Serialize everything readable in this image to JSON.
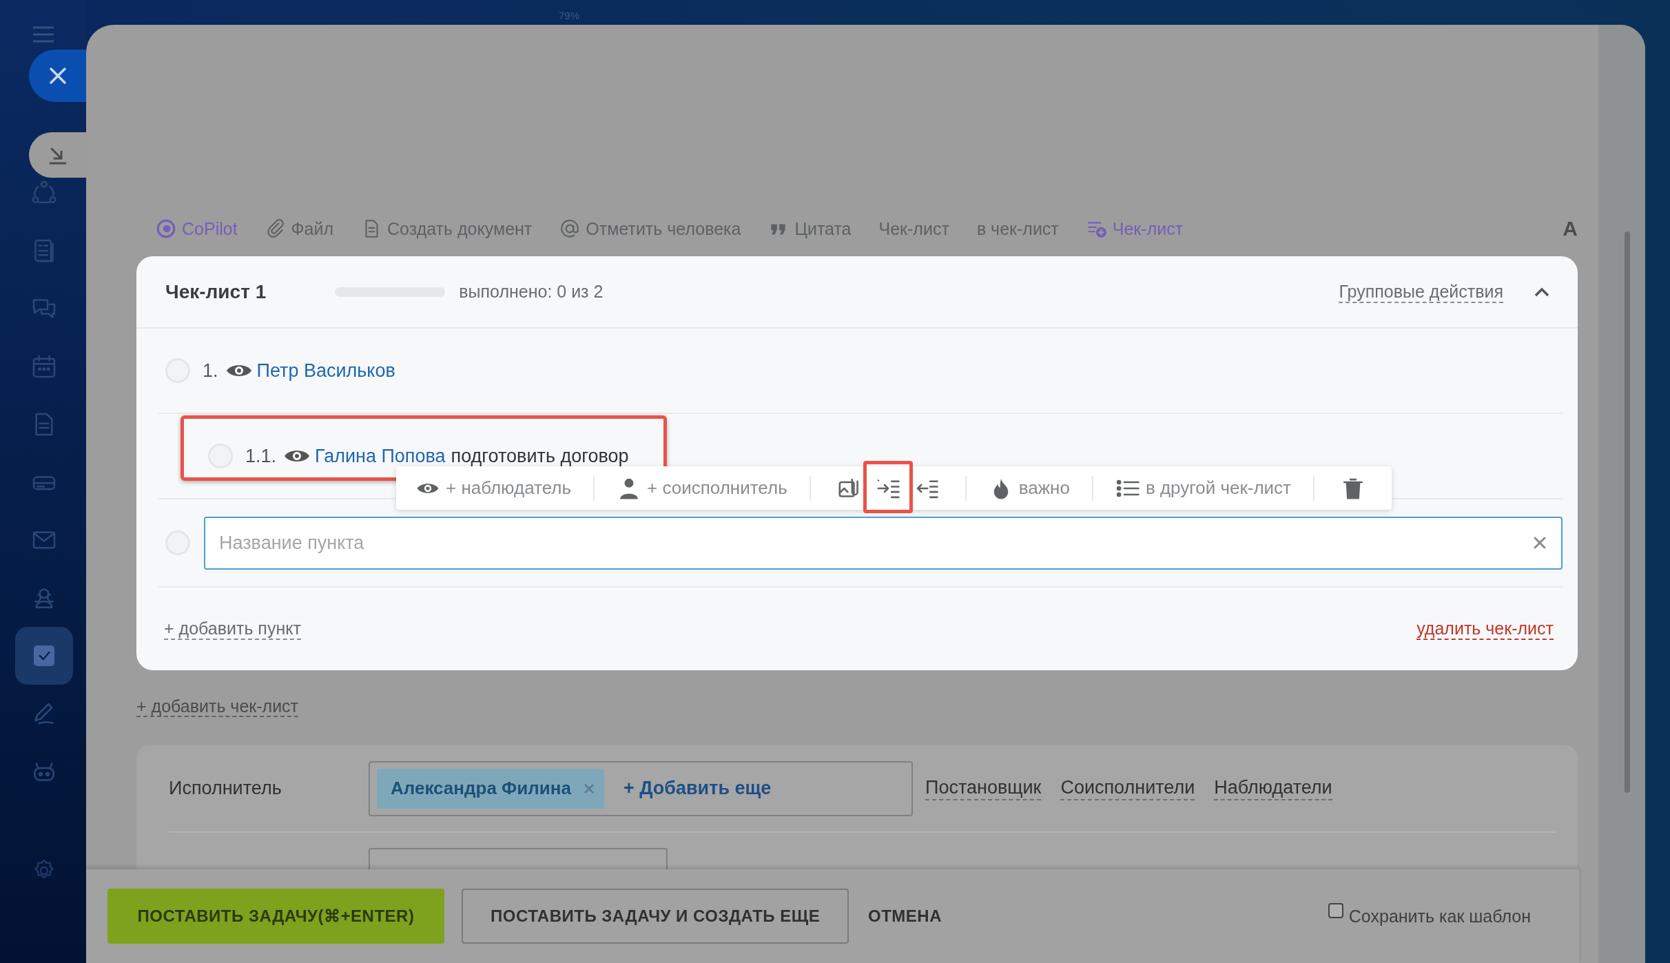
{
  "zoom_label": "79%",
  "sidebar": {
    "items": [
      {
        "selected": false
      },
      {
        "selected": false
      },
      {
        "selected": false
      },
      {
        "selected": false
      },
      {
        "selected": false
      },
      {
        "selected": false
      },
      {
        "selected": false
      },
      {
        "selected": false
      },
      {
        "selected": true
      },
      {
        "selected": false
      },
      {
        "selected": false
      },
      {
        "selected": false
      }
    ]
  },
  "toolbar": [
    {
      "kind": "copilot",
      "label": "CoPilot"
    },
    {
      "kind": "file",
      "label": "Файл"
    },
    {
      "kind": "doc",
      "label": "Создать документ"
    },
    {
      "kind": "mention",
      "label": "Отметить человека"
    },
    {
      "kind": "quote",
      "label": "Цитата"
    },
    {
      "kind": "plain",
      "label": "Чек-лист"
    },
    {
      "kind": "plain",
      "label": "в чек-лист"
    },
    {
      "kind": "checklist",
      "label": "Чек-лист"
    },
    {
      "kind": "format",
      "label": "A"
    }
  ],
  "checklist": {
    "title": "Чек-лист 1",
    "level": 0,
    "progress_text": "выполнено: 0 из 2",
    "group_actions": "Групповые действия",
    "expanded": true,
    "items": [
      {
        "number": "1.",
        "person": "Петр Васильков",
        "checked": false,
        "children": [
          {
            "number": "1.1.",
            "person": "Галина Попова",
            "text": "подготовить договор",
            "checked": false,
            "highlighted": true
          }
        ]
      }
    ],
    "item_actions": [
      {
        "kind": "observer",
        "label": "+ наблюдатель"
      },
      {
        "kind": "coexecutor",
        "label": "+ соисполнитель"
      },
      {
        "kind": "attach"
      },
      {
        "kind": "indent",
        "highlighted": true
      },
      {
        "kind": "outdent"
      },
      {
        "kind": "important",
        "label": "важно"
      },
      {
        "kind": "move",
        "label": "в другой чек-лист"
      },
      {
        "kind": "delete"
      }
    ],
    "new_item": {
      "placeholder": "Название пункта",
      "checked": false
    },
    "add_item": "+ добавить пункт",
    "delete_checklist": "удалить чек-лист"
  },
  "add_checklist": "+ добавить чек-лист",
  "responsible": {
    "label": "Исполнитель",
    "tags": [
      {
        "name": "Александра Филина"
      }
    ],
    "add_more": "+ Добавить еще",
    "links": [
      "Постановщик",
      "Соисполнители",
      "Наблюдатели"
    ]
  },
  "footer": {
    "buttons": [
      {
        "kind": "primary",
        "label": "ПОСТАВИТЬ ЗАДАЧУ(⌘+ENTER)"
      },
      {
        "kind": "secondary",
        "label": "ПОСТАВИТЬ ЗАДАЧУ И СОЗДАТЬ ЕЩЕ"
      },
      {
        "kind": "link",
        "label": "ОТМЕНА"
      }
    ],
    "save_template": {
      "label": "Сохранить как шаблон",
      "checked": false
    }
  }
}
